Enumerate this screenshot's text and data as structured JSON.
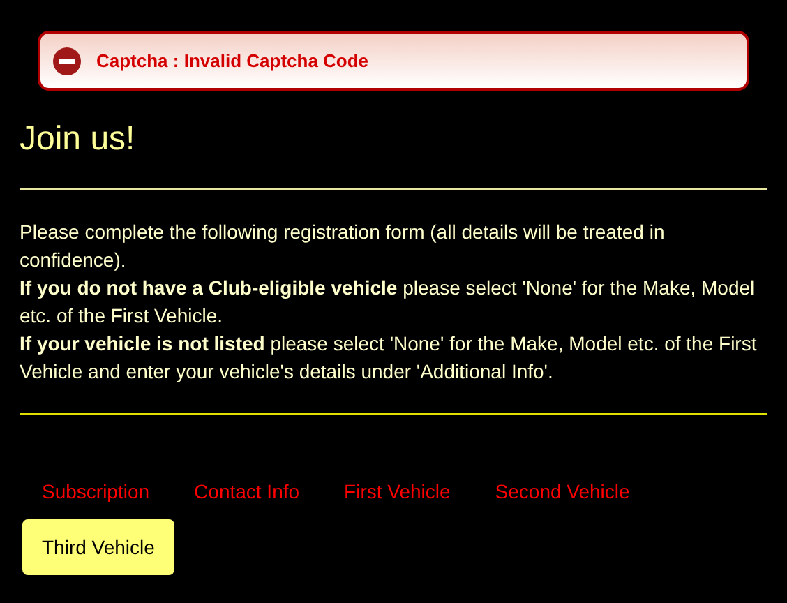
{
  "alert": {
    "message": "Captcha : Invalid Captcha Code"
  },
  "heading": "Join us!",
  "intro": [
    "Please complete the following registration form (all details will be treated in confidence).",
    "**If you do not have a Club-eligible vehicle** please select 'None' for the Make, Model etc. of the First Vehicle.",
    "**If your vehicle is not listed** please select 'None' for the Make, Model etc. of the First Vehicle and enter your vehicle's details under 'Additional Info'."
  ],
  "tabs": [
    {
      "label": "Subscription",
      "selected": false
    },
    {
      "label": "Contact Info",
      "selected": false
    },
    {
      "label": "First Vehicle",
      "selected": false
    },
    {
      "label": "Second Vehicle",
      "selected": false
    },
    {
      "label": "Third Vehicle",
      "selected": true
    }
  ]
}
